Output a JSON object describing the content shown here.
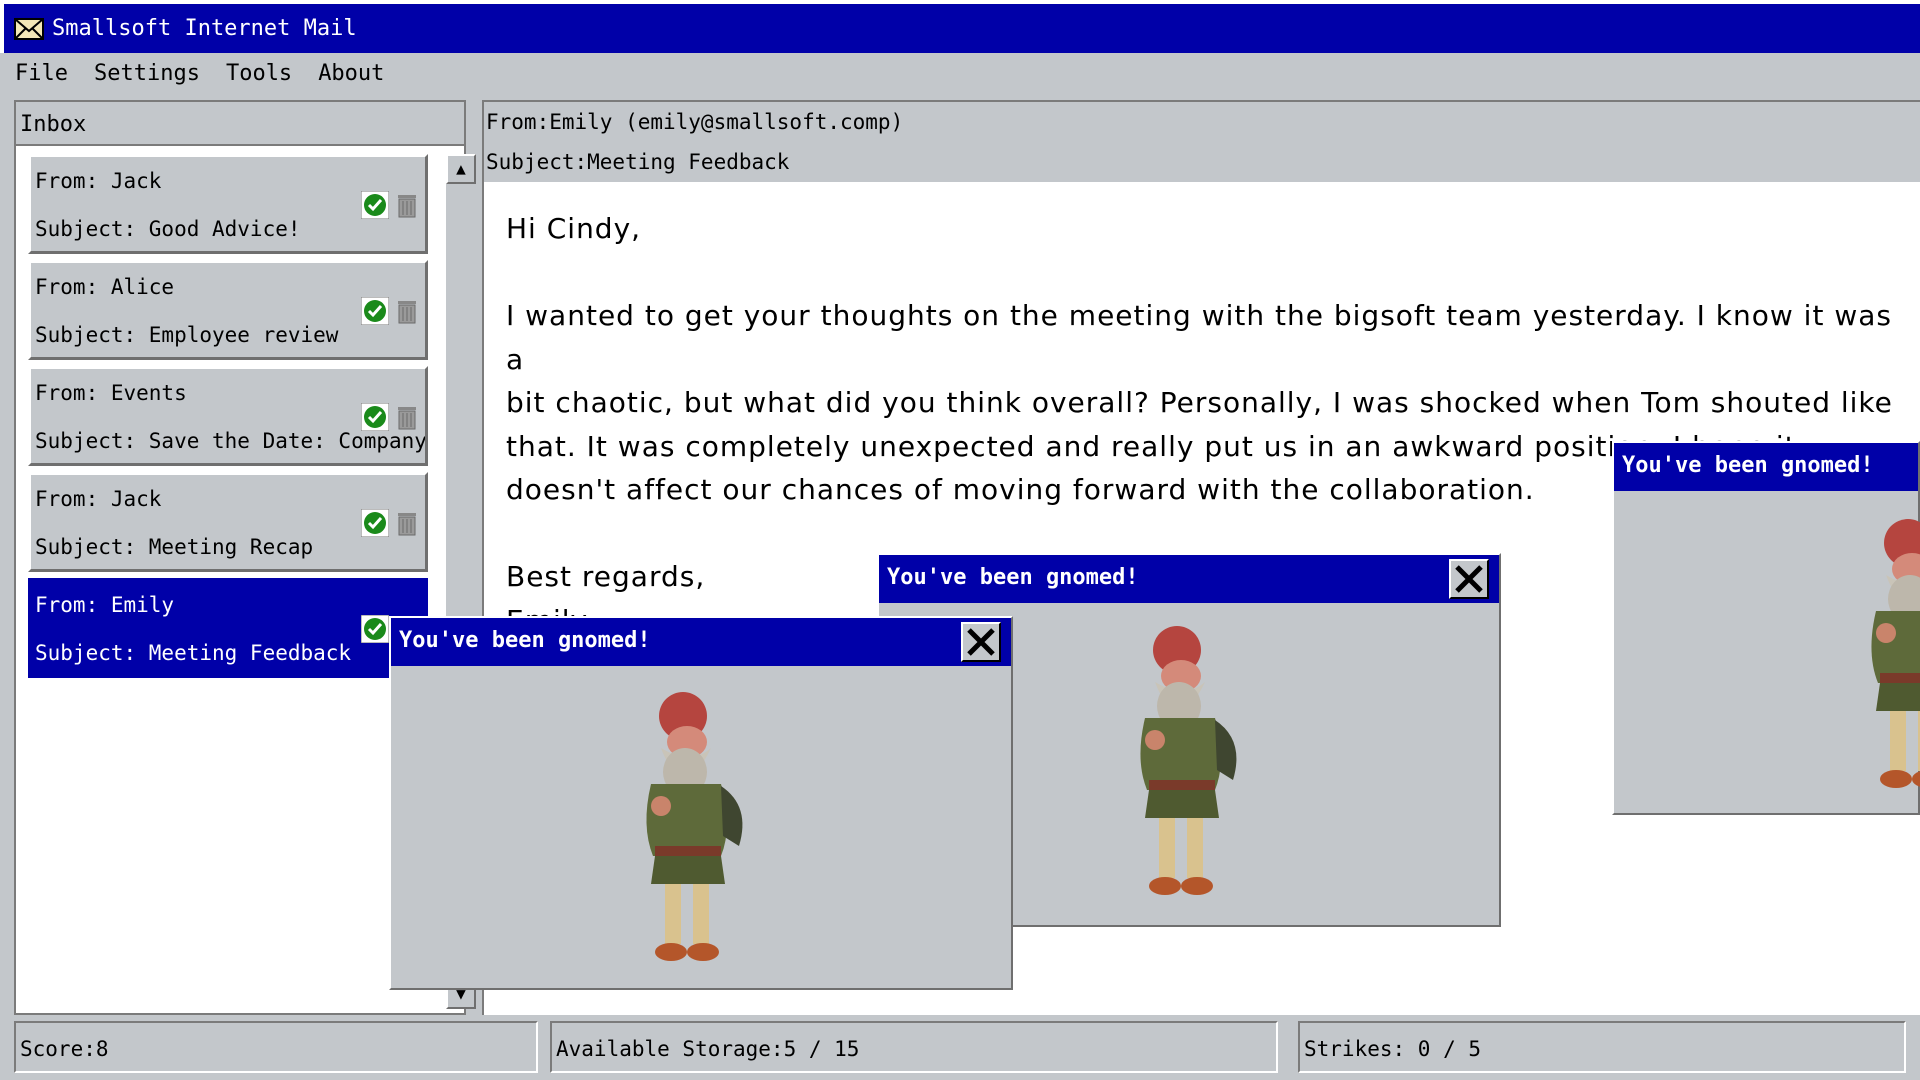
{
  "window": {
    "title": "Smallsoft Internet Mail"
  },
  "menu": [
    "File",
    "Settings",
    "Tools",
    "About"
  ],
  "inbox": {
    "label": "Inbox",
    "items": [
      {
        "from": "From: Jack",
        "subject": "Subject: Good Advice!"
      },
      {
        "from": "From: Alice",
        "subject": "Subject: Employee review"
      },
      {
        "from": "From: Events",
        "subject": "Subject: Save the Date: Company.."
      },
      {
        "from": "From: Jack",
        "subject": "Subject: Meeting Recap"
      },
      {
        "from": "From: Emily",
        "subject": "Subject: Meeting Feedback"
      }
    ]
  },
  "message": {
    "from": "From:Emily (emily@smallsoft.comp)",
    "subject": "Subject:Meeting Feedback",
    "greeting": "Hi Cindy,",
    "body": "I wanted to get your thoughts on the meeting with the bigsoft team yesterday. I know it was a\nbit chaotic, but what did you think overall? Personally, I was shocked when Tom shouted like\nthat. It was completely unexpected and really put us in an awkward position. I hope it\ndoesn't affect our chances of moving forward with the collaboration.",
    "closing": "Best regards,\nEmily"
  },
  "status": {
    "score": "Score:8",
    "storage": "Available Storage:5 / 15",
    "strikes": "Strikes: 0 / 5"
  },
  "popups": [
    {
      "title": "You've been gnomed!"
    },
    {
      "title": "You've been gnomed!"
    },
    {
      "title": "You've been gnomed!"
    }
  ],
  "colors": {
    "titlebar": "#0000a8",
    "window_bg": "#c3c7cb",
    "check": "#1a8a1a"
  },
  "icons": [
    "envelope-icon",
    "check-icon",
    "trash-icon",
    "close-icon",
    "gnome-image"
  ]
}
